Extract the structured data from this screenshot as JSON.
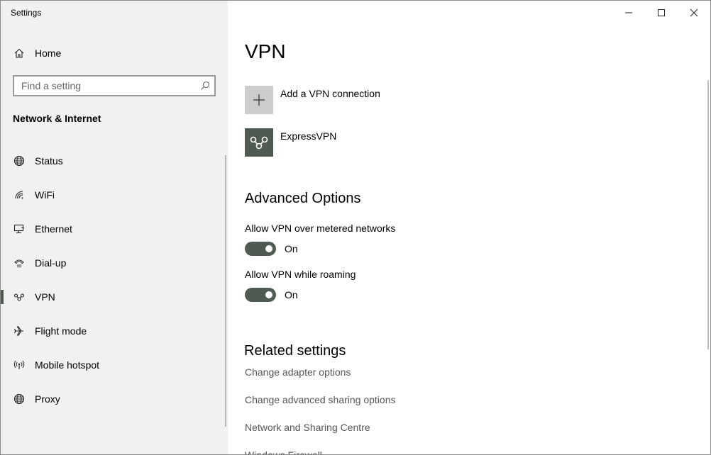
{
  "window": {
    "title": "Settings"
  },
  "sidebar": {
    "home_label": "Home",
    "search_placeholder": "Find a setting",
    "section_title": "Network & Internet",
    "items": [
      {
        "label": "Status",
        "icon": "globe-icon"
      },
      {
        "label": "WiFi",
        "icon": "wifi-icon"
      },
      {
        "label": "Ethernet",
        "icon": "ethernet-icon"
      },
      {
        "label": "Dial-up",
        "icon": "dialup-icon"
      },
      {
        "label": "VPN",
        "icon": "vpn-icon",
        "active": true
      },
      {
        "label": "Flight mode",
        "icon": "airplane-icon"
      },
      {
        "label": "Mobile hotspot",
        "icon": "hotspot-icon"
      },
      {
        "label": "Proxy",
        "icon": "globe-icon"
      }
    ]
  },
  "main": {
    "title": "VPN",
    "add_vpn_label": "Add a VPN connection",
    "connections": [
      {
        "name": "ExpressVPN",
        "icon": "expressvpn-logo-icon"
      }
    ],
    "advanced": {
      "heading": "Advanced Options",
      "options": [
        {
          "label": "Allow VPN over metered networks",
          "state": "On"
        },
        {
          "label": "Allow VPN while roaming",
          "state": "On"
        }
      ]
    },
    "related": {
      "heading": "Related settings",
      "links": [
        "Change adapter options",
        "Change advanced sharing options",
        "Network and Sharing Centre",
        "Windows Firewall"
      ]
    }
  },
  "colors": {
    "accent": "#4f5b51",
    "sidebar_bg": "#f1f1f1",
    "tile_bg": "#cccccc"
  }
}
